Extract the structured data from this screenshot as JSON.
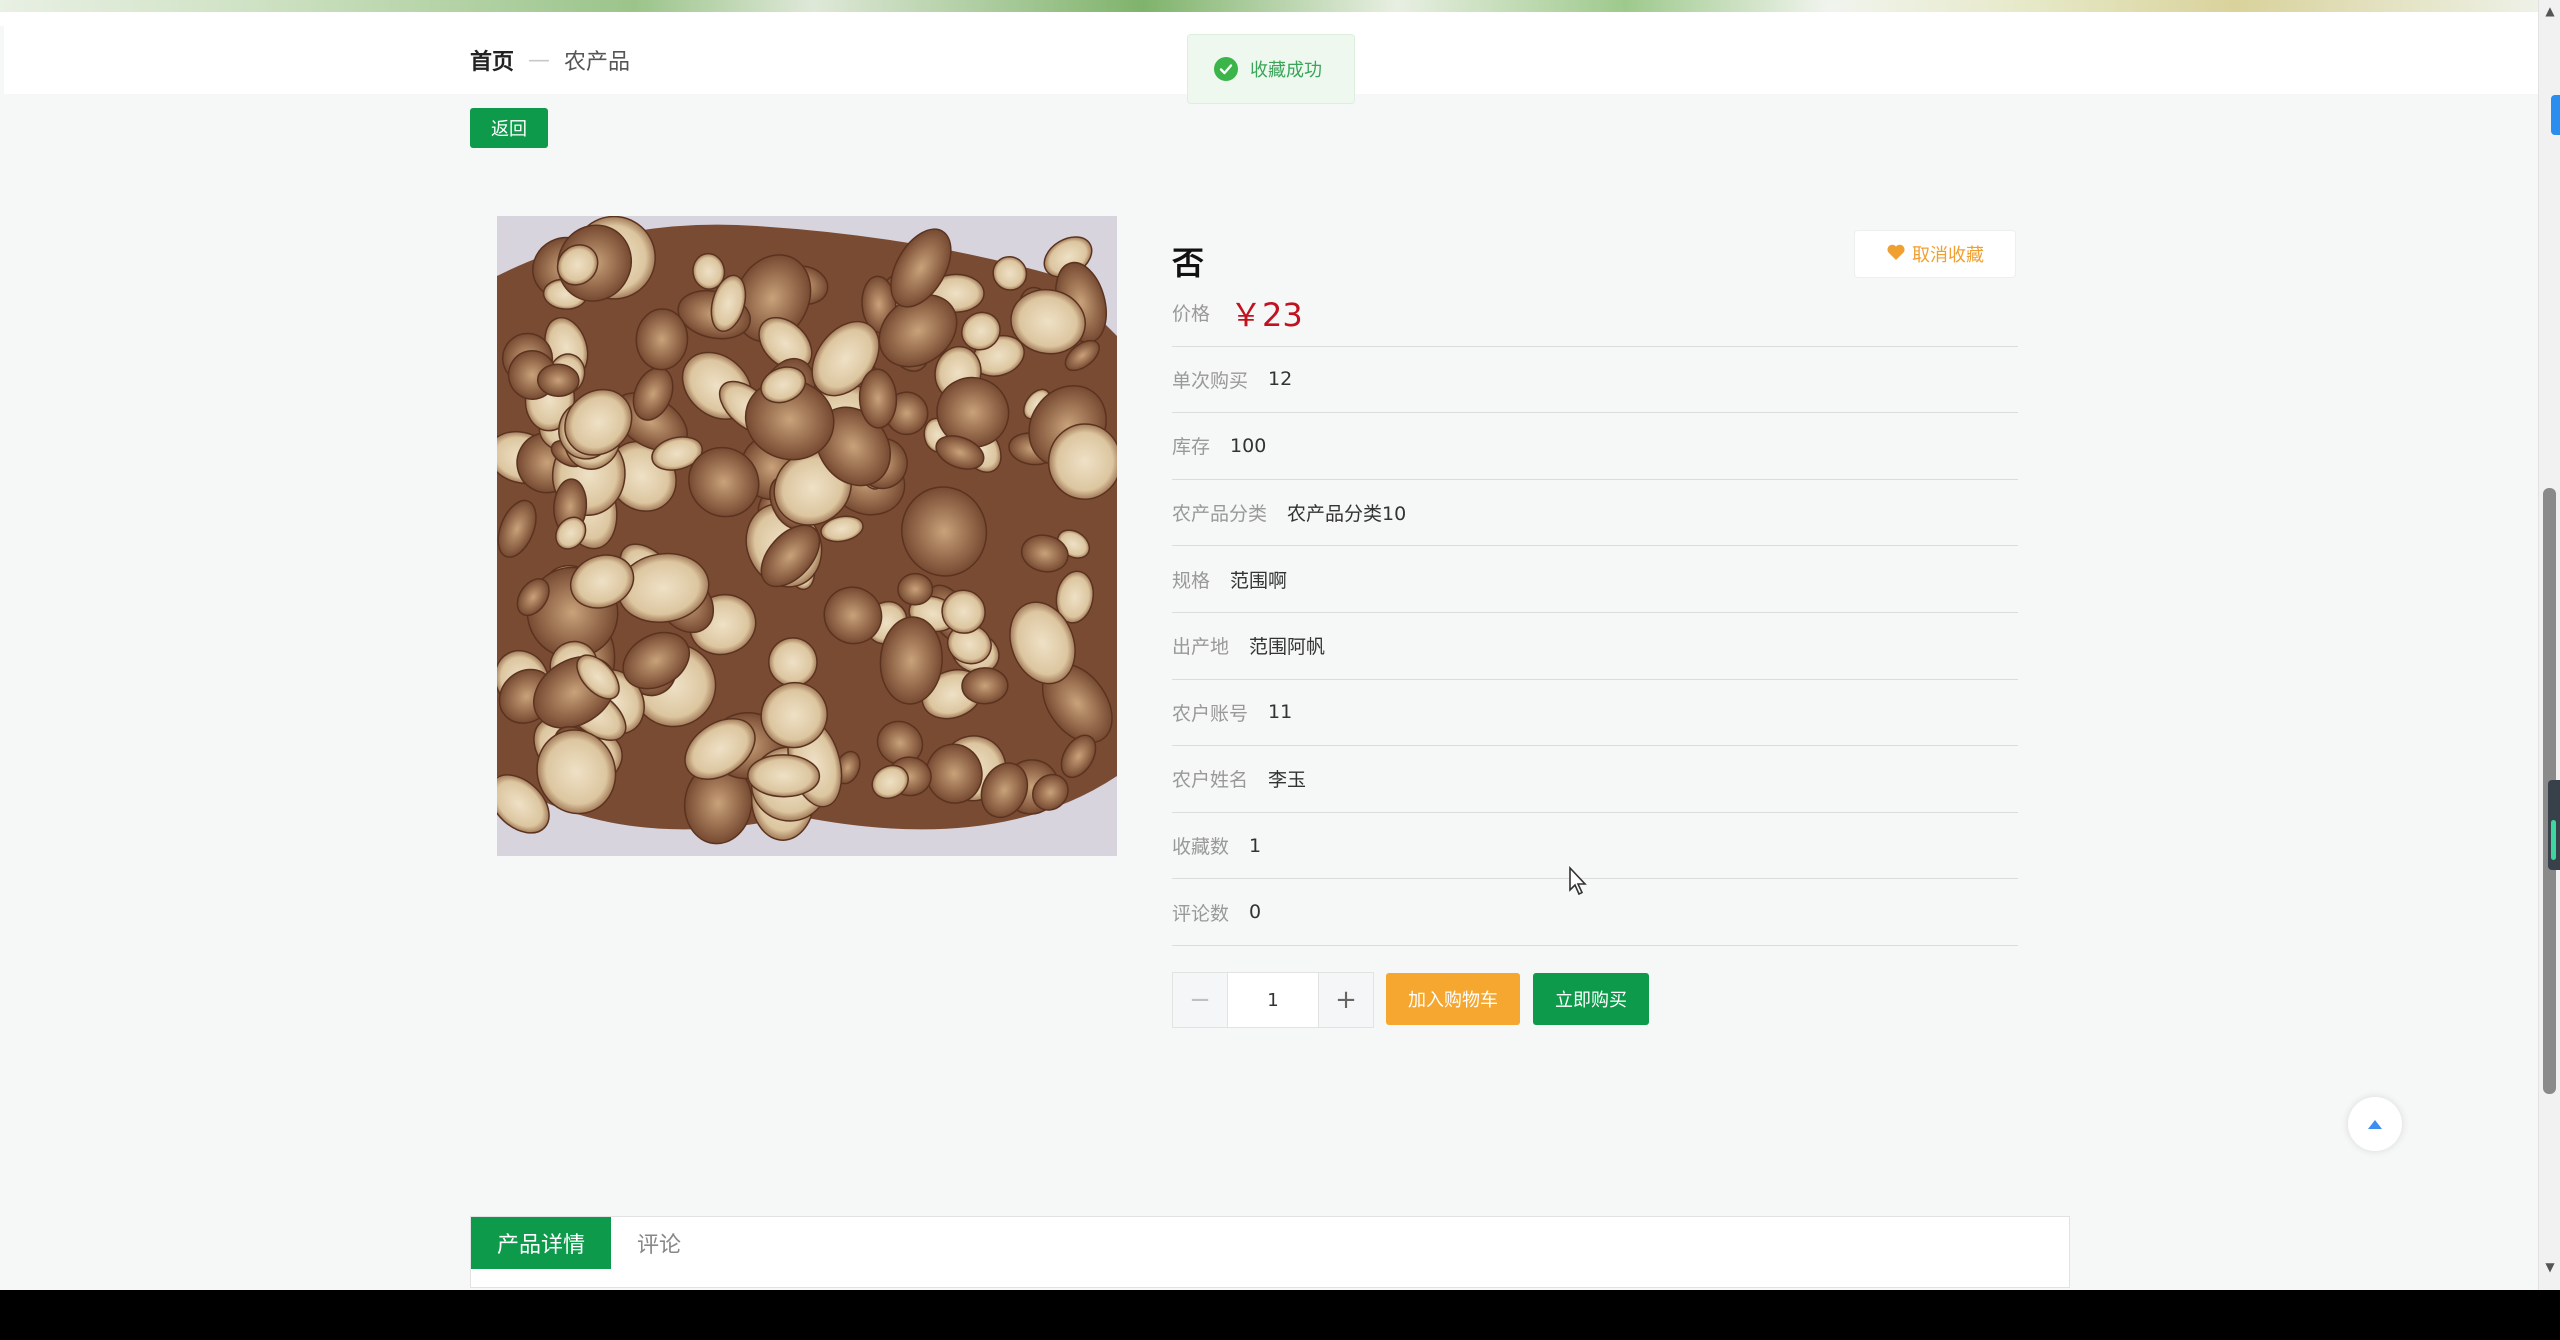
{
  "breadcrumb": {
    "home": "首页",
    "separator": "—",
    "current": "农产品"
  },
  "toast": {
    "message": "收藏成功",
    "icon": "check-circle-icon",
    "color": "#3bb44a"
  },
  "back_button": {
    "label": "返回"
  },
  "product": {
    "title": "否",
    "favorite_button": {
      "label": "取消收藏",
      "icon": "heart-icon",
      "color": "#f0a030"
    },
    "price": {
      "label": "价格",
      "value": "￥23",
      "color": "#c0121f"
    },
    "fields": [
      {
        "label": "单次购买",
        "value": "12"
      },
      {
        "label": "库存",
        "value": "100"
      },
      {
        "label": "农产品分类",
        "value": "农产品分类10"
      },
      {
        "label": "规格",
        "value": "范围啊"
      },
      {
        "label": "出产地",
        "value": "范围阿帆"
      },
      {
        "label": "农户账号",
        "value": "11"
      },
      {
        "label": "农户姓名",
        "value": "李玉"
      },
      {
        "label": "收藏数",
        "value": "1"
      },
      {
        "label": "评论数",
        "value": "0"
      }
    ]
  },
  "quantity": {
    "minus": "−",
    "value": "1",
    "plus": "+"
  },
  "actions": {
    "add_to_cart": "加入购物车",
    "buy_now": "立即购买",
    "cart_color": "#f5a730",
    "buy_color": "#0d9a4a"
  },
  "tabs": [
    {
      "label": "产品详情",
      "active": true
    },
    {
      "label": "评论",
      "active": false
    }
  ],
  "accent_color": "#0d9a4a"
}
